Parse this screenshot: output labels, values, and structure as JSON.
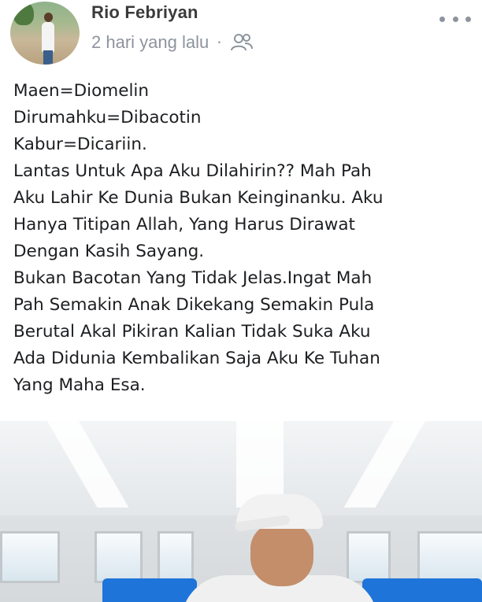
{
  "post": {
    "author_name": "Rio Febriyan",
    "timestamp": "2 hari yang lalu",
    "separator": "·",
    "audience_icon": "friends-icon",
    "more_icon": "more-dots-icon",
    "text_lines": [
      "Maen=Diomelin",
      "Dirumahku=Dibacotin",
      "Kabur=Dicariin.",
      "Lantas Untuk Apa Aku Dilahirin?? Mah Pah",
      "Aku Lahir Ke Dunia Bukan Keinginanku. Aku",
      "Hanya Titipan Allah, Yang Harus Dirawat",
      "Dengan Kasih Sayang.",
      "Bukan Bacotan Yang Tidak Jelas.Ingat Mah",
      "Pah Semakin Anak Dikekang Semakin Pula",
      "Berutal Akal Pikiran Kalian Tidak Suka Aku",
      "Ada Didunia Kembalikan Saja Aku Ke Tuhan",
      "Yang Maha Esa."
    ]
  },
  "colors": {
    "name": "#3b3b3b",
    "meta": "#8d949e",
    "text": "#1c1e21",
    "seat_blue": "#1e74d9"
  }
}
